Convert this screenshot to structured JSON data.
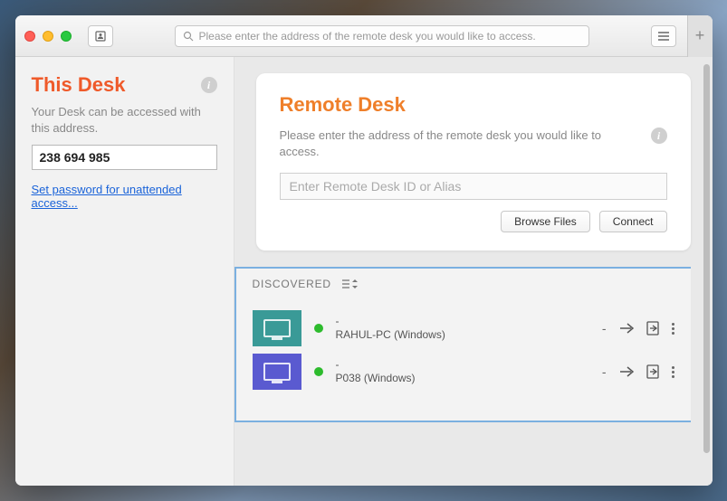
{
  "toolbar": {
    "search_placeholder": "Please enter the address of the remote desk you would like to access."
  },
  "sidebar": {
    "title": "This Desk",
    "description": "Your Desk can be accessed with this address.",
    "address": "238 694 985",
    "password_link": "Set password for unattended access..."
  },
  "remote": {
    "title": "Remote Desk",
    "description": "Please enter the address of the remote desk you would like to access.",
    "placeholder": "Enter Remote Desk ID or Alias",
    "browse_label": "Browse Files",
    "connect_label": "Connect"
  },
  "discovered": {
    "heading": "DISCOVERED",
    "items": [
      {
        "alias": "-",
        "name": "RAHUL-PC (Windows)",
        "status": "online",
        "thumb_color": "teal",
        "last": "-"
      },
      {
        "alias": "-",
        "name": "P038 (Windows)",
        "status": "online",
        "thumb_color": "blue",
        "last": "-"
      }
    ]
  }
}
